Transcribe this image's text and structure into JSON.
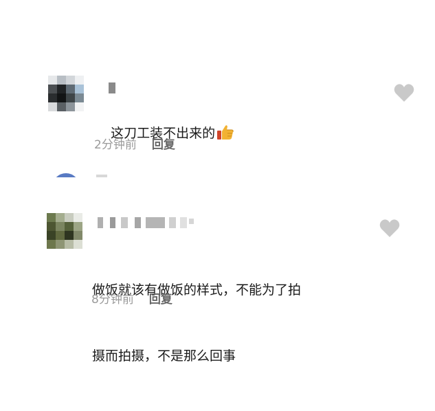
{
  "comments": [
    {
      "text": "这刀工装不出来的",
      "emoji": "thumbs-up",
      "time": "2分钟前",
      "reply_label": "回复"
    },
    {
      "text_line1": "做饭就该有做饭的样式，不能为了拍",
      "text_line2": "摄而拍摄，不是那么回事",
      "time": "8分钟前",
      "reply_label": "回复"
    }
  ],
  "colors": {
    "text": "#1a1a1a",
    "meta": "#9a9a9a",
    "reply": "#666666",
    "heart": "#c9c9c9"
  }
}
